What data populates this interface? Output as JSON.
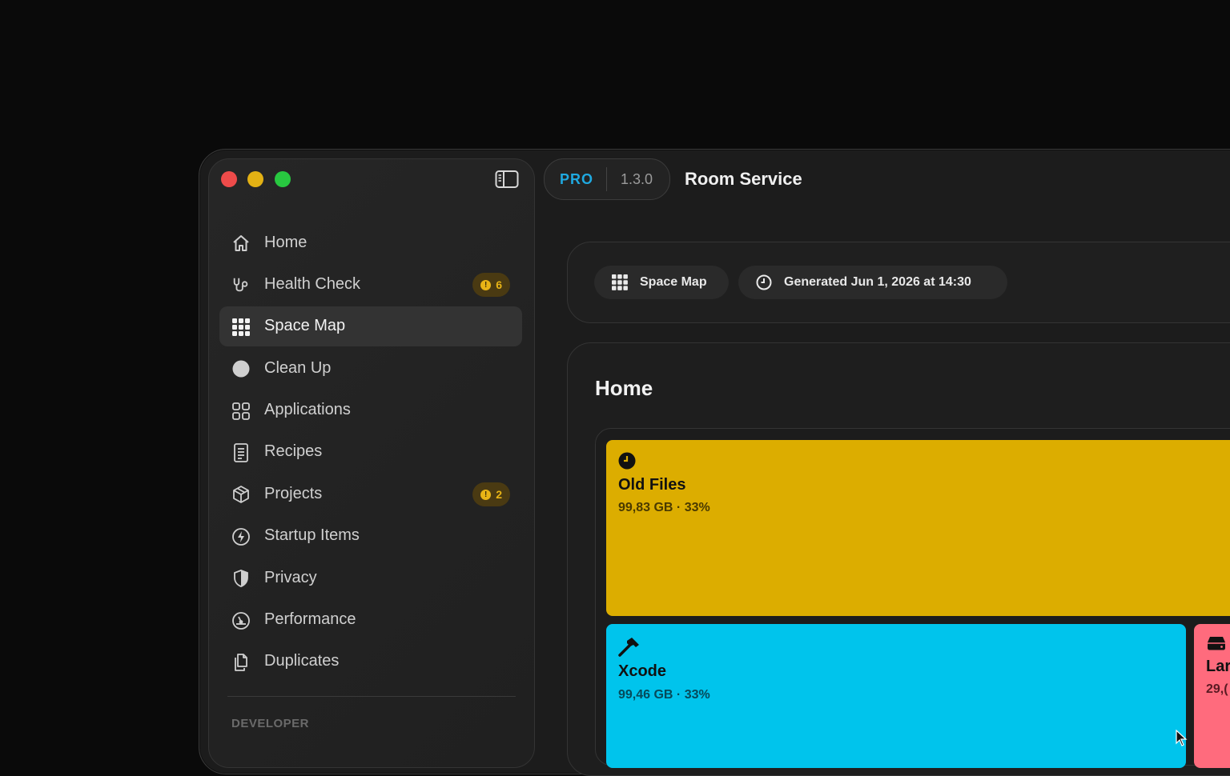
{
  "app": {
    "edition": "PRO",
    "version": "1.3.0",
    "title": "Room Service"
  },
  "sidebar": {
    "items": [
      {
        "label": "Home",
        "icon": "house-icon"
      },
      {
        "label": "Health Check",
        "icon": "stethoscope-icon",
        "badge": "6"
      },
      {
        "label": "Space Map",
        "icon": "grid-icon",
        "active": true
      },
      {
        "label": "Clean Up",
        "icon": "circle-icon"
      },
      {
        "label": "Applications",
        "icon": "apps-grid-icon"
      },
      {
        "label": "Recipes",
        "icon": "document-icon"
      },
      {
        "label": "Projects",
        "icon": "cube-icon",
        "badge": "2"
      },
      {
        "label": "Startup Items",
        "icon": "bolt-circle-icon"
      },
      {
        "label": "Privacy",
        "icon": "shield-icon"
      },
      {
        "label": "Performance",
        "icon": "gauge-icon"
      },
      {
        "label": "Duplicates",
        "icon": "copy-icon"
      }
    ],
    "section_label": "DEVELOPER"
  },
  "toolbar": {
    "space_map_label": "Space Map",
    "generated_label": "Generated Jun 1, 2026 at 14:30"
  },
  "content": {
    "title": "Home",
    "tiles": [
      {
        "name": "Old Files",
        "size": "99,83 GB · 33%",
        "color": "#dcad00",
        "icon": "clock-icon"
      },
      {
        "name": "Xcode",
        "size": "99,46 GB · 33%",
        "color": "#00c4ec",
        "icon": "hammer-icon"
      },
      {
        "name": "Lar",
        "size": "29,(",
        "color": "#ff6b7d",
        "icon": "drive-icon"
      }
    ]
  }
}
